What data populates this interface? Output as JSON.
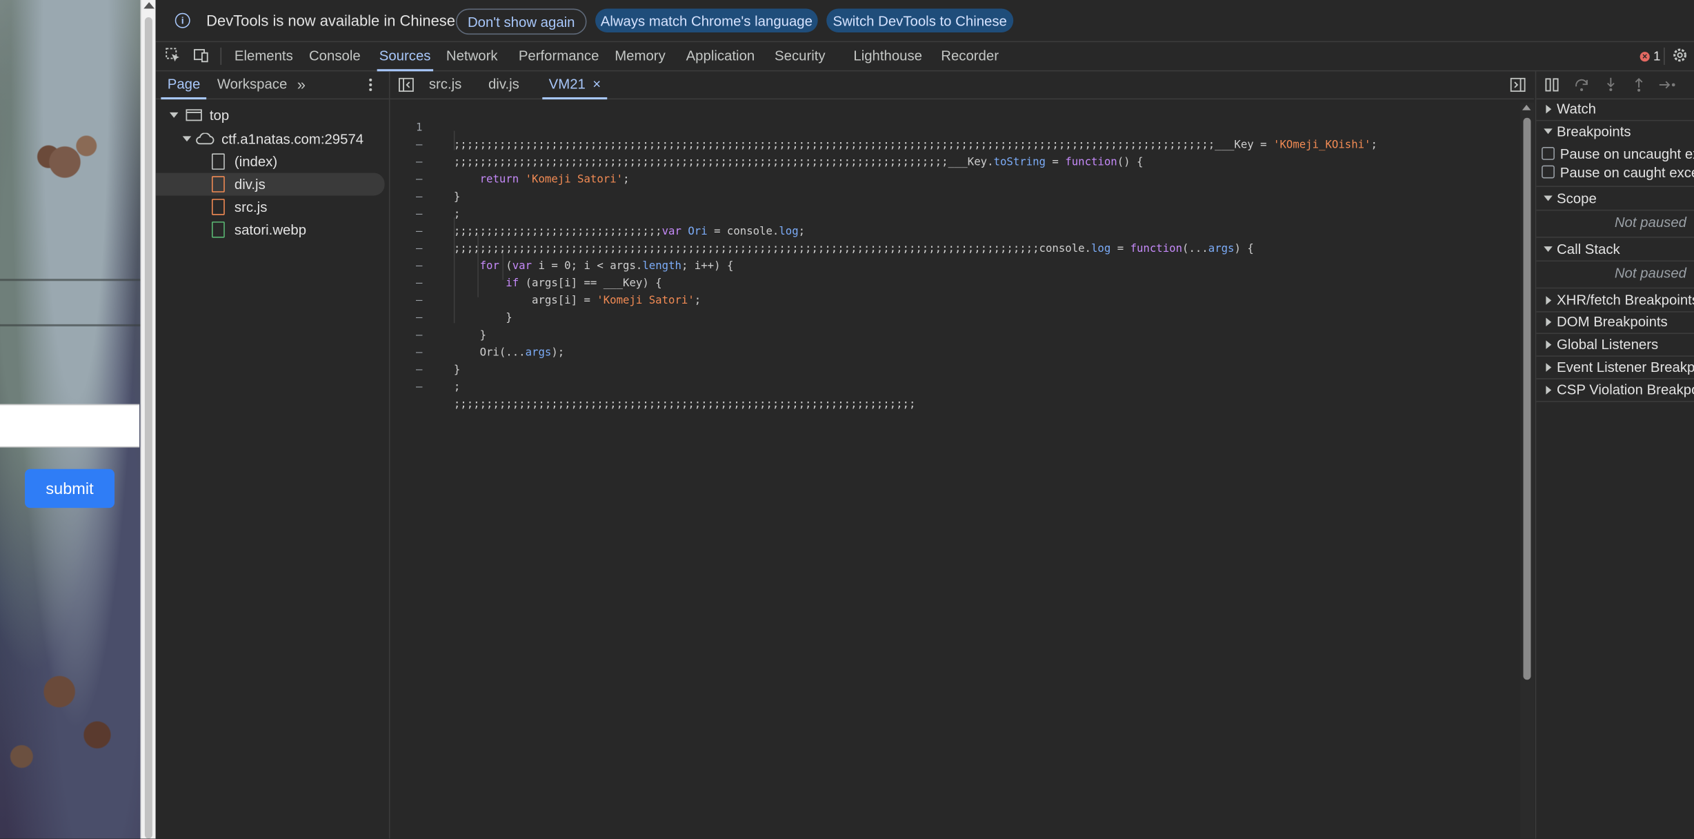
{
  "page": {
    "submit_label": "submit"
  },
  "infobar": {
    "message": "DevTools is now available in Chinese",
    "dont_show_again": "Don't show again",
    "always_match": "Always match Chrome's language",
    "switch_chinese": "Switch DevTools to Chinese"
  },
  "main_tabs": [
    "Elements",
    "Console",
    "Sources",
    "Network",
    "Performance",
    "Memory",
    "Application",
    "Security",
    "Lighthouse",
    "Recorder"
  ],
  "active_main_tab": "Sources",
  "error_count": "1",
  "navigator": {
    "tabs": [
      "Page",
      "Workspace"
    ],
    "more": "»",
    "tree": {
      "top": "top",
      "origin": "ctf.a1natas.com:29574",
      "files": [
        "(index)",
        "div.js",
        "src.js",
        "satori.webp"
      ]
    },
    "selected_file": "div.js"
  },
  "editor": {
    "tabs": [
      "src.js",
      "div.js",
      "VM21"
    ],
    "active_tab": "VM21",
    "gutter": [
      "1",
      "–",
      "–",
      "–",
      "–",
      "–",
      "–",
      "–",
      "–",
      "–",
      "–",
      "–",
      "–",
      "–",
      "–",
      "–"
    ],
    "code_lines": [
      ";;;;;;;;;;;;;;;;;;;;;;;;;;;;;;;;;;;;;;;;;;;;;;;;;;;;;;;;;;;;;;;;;;;;;;;;;;;;;;;;;;;;;;;;;;;;;;;;;;;;;;;;;;;;;;;;;;;;;___Key = 'KOmeji_KOishi';",
      ";;;;;;;;;;;;;;;;;;;;;;;;;;;;;;;;;;;;;;;;;;;;;;;;;;;;;;;;;;;;;;;;;;;;;;;;;;;;___Key.toString = function() {",
      "    return 'Komeji Satori';",
      "}",
      ";",
      ";;;;;;;;;;;;;;;;;;;;;;;;;;;;;;;;var Ori = console.log;",
      ";;;;;;;;;;;;;;;;;;;;;;;;;;;;;;;;;;;;;;;;;;;;;;;;;;;;;;;;;;;;;;;;;;;;;;;;;;;;;;;;;;;;;;;;;;console.log = function(...args) {",
      "    for (var i = 0; i < args.length; i++) {",
      "        if (args[i] == ___Key) {",
      "            args[i] = 'Komeji Satori';",
      "        }",
      "    }",
      "    Ori(...args);",
      "}",
      ";",
      ";;;;;;;;;;;;;;;;;;;;;;;;;;;;;;;;;;;;;;;;;;;;;;;;;;;;;;;;;;;;;;;;;;;;;;;"
    ]
  },
  "debugger": {
    "watch": "Watch",
    "breakpoints": "Breakpoints",
    "pause_uncaught": "Pause on uncaught exceptions",
    "pause_caught": "Pause on caught exceptions",
    "scope": "Scope",
    "not_paused_scope": "Not paused",
    "call_stack": "Call Stack",
    "not_paused_stack": "Not paused",
    "xhr": "XHR/fetch Breakpoints",
    "dom": "DOM Breakpoints",
    "global": "Global Listeners",
    "event": "Event Listener Breakpoints",
    "csp": "CSP Violation Breakpoints"
  }
}
